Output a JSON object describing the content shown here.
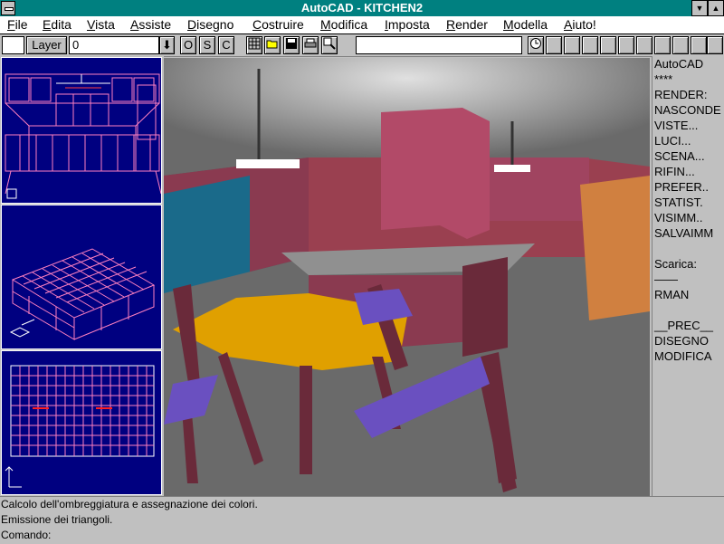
{
  "window": {
    "title": "AutoCAD - KITCHEN2",
    "minimize_glyph": "▼",
    "maximize_glyph": "▲"
  },
  "menu": [
    "File",
    "Edita",
    "Vista",
    "Assiste",
    "Disegno",
    "Costruire",
    "Modifica",
    "Imposta",
    "Render",
    "Modella",
    "Aiuto!"
  ],
  "toolbar": {
    "layer_button": "Layer",
    "layer_value": "0",
    "dropdown_glyph": "⬇",
    "ortho": "O",
    "snap": "S",
    "coords": "C",
    "icons": [
      "grid-icon",
      "open-icon",
      "save-icon",
      "print-icon",
      "zoom-icon",
      "clock-icon"
    ]
  },
  "side_menu": [
    "AutoCAD",
    "****",
    "RENDER:",
    "NASCONDE",
    "VISTE...",
    "LUCI...",
    "SCENA...",
    "RIFIN...",
    "PREFER..",
    "STATIST.",
    "VISIMM..",
    "SALVAIMM",
    "",
    "Scarica:",
    "——",
    "RMAN",
    "",
    "__PREC__",
    "DISEGNO",
    "MODIFICA"
  ],
  "command_area": {
    "line1": "Calcolo dell'ombreggiatura e assegnazione dei colori.",
    "line2": "Emissione dei triangoli.",
    "line3": "Comando:"
  },
  "colors": {
    "titlebar": "#008080",
    "viewport_bg": "#000080",
    "cabinet": "#b03a5a",
    "table": "#e0a000",
    "chair_seat": "#6a50c0",
    "fridge": "#d08040"
  }
}
